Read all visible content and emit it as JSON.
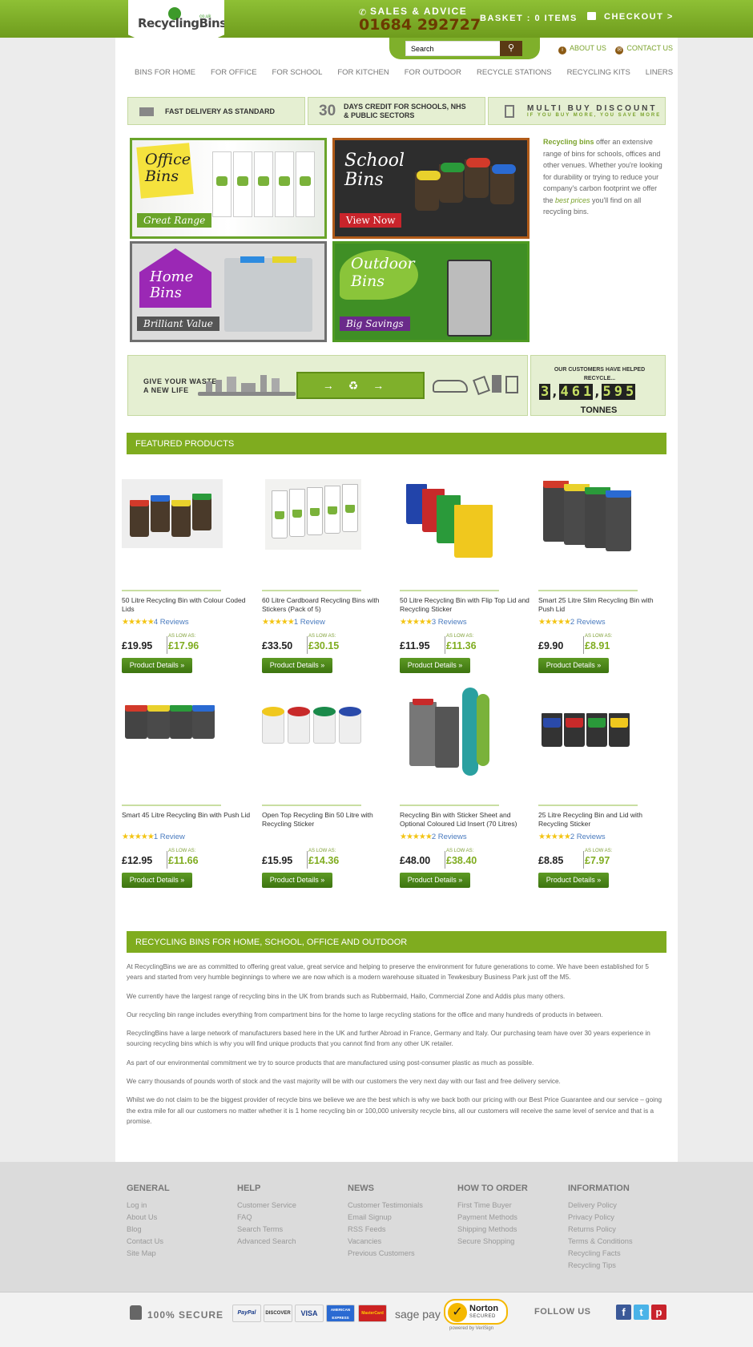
{
  "header": {
    "logo_text": "RecyclingBins",
    "logo_suffix": "co.uk",
    "sales_label": "SALES & ADVICE",
    "phone": "01684 292727",
    "basket": "BASKET : 0 ITEMS",
    "checkout": "CHECKOUT >"
  },
  "search": {
    "placeholder": "Search",
    "value": "Search"
  },
  "toplinks": {
    "about": "ABOUT US",
    "contact": "CONTACT US"
  },
  "nav": [
    "BINS FOR HOME",
    "FOR OFFICE",
    "FOR SCHOOL",
    "FOR KITCHEN",
    "FOR OUTDOOR",
    "RECYCLE STATIONS",
    "RECYCLING KITS",
    "LINERS"
  ],
  "usp": {
    "delivery": "FAST DELIVERY AS STANDARD",
    "credit_num": "30",
    "credit_line1": "DAYS CREDIT FOR SCHOOLS, NHS",
    "credit_line2": "& PUBLIC SECTORS",
    "multibuy": "MULTI BUY DISCOUNT",
    "multibuy_sub": "IF YOU BUY MORE, YOU SAVE MORE"
  },
  "tiles": {
    "office": {
      "heading": "Office Bins",
      "tag": "Great Range"
    },
    "school": {
      "heading": "School Bins",
      "tag": "View Now"
    },
    "home": {
      "heading": "Home Bins",
      "tag": "Brilliant Value"
    },
    "outdoor": {
      "heading": "Outdoor Bins",
      "tag": "Big Savings"
    }
  },
  "blurb": {
    "strong": "Recycling bins",
    "text1": " offer an extensive range of bins for schools, offices and other venues. Whether you're looking for durability or trying to reduce your company's carbon footprint we offer the ",
    "em": "best prices",
    "text2": " you'll find on all recycling bins."
  },
  "life": {
    "line1": "GIVE YOUR WASTE",
    "line2": "A NEW LIFE",
    "counter_title": "OUR CUSTOMERS HAVE HELPED RECYCLE...",
    "digits": [
      "3",
      ",",
      "4",
      "6",
      "1",
      ",",
      "5",
      "9",
      "5"
    ],
    "unit": "TONNES"
  },
  "featured_title": "FEATURED PRODUCTS",
  "products": [
    {
      "name": "50 Litre Recycling Bin with Colour Coded Lids",
      "stars": "★★★★★",
      "reviews": "4 Reviews",
      "price": "£19.95",
      "as_low_as": "AS LOW AS:",
      "sale": "£17.96",
      "button": "Product Details »"
    },
    {
      "name": "60 Litre Cardboard Recycling Bins with Stickers (Pack of 5)",
      "stars": "★★★★★",
      "reviews": "1 Review",
      "price": "£33.50",
      "as_low_as": "AS LOW AS:",
      "sale": "£30.15",
      "button": "Product Details »"
    },
    {
      "name": "50 Litre Recycling Bin with Flip Top Lid and Recycling Sticker",
      "stars": "★★★★★",
      "reviews": "3 Reviews",
      "price": "£11.95",
      "as_low_as": "AS LOW AS:",
      "sale": "£11.36",
      "button": "Product Details »"
    },
    {
      "name": "Smart 25 Litre Slim Recycling Bin with Push Lid",
      "stars": "★★★★★",
      "reviews": "2 Reviews",
      "price": "£9.90",
      "as_low_as": "AS LOW AS:",
      "sale": "£8.91",
      "button": "Product Details »"
    },
    {
      "name": "Smart 45 Litre Recycling Bin with Push Lid",
      "stars": "★★★★★",
      "reviews": "1 Review",
      "price": "£12.95",
      "as_low_as": "AS LOW AS:",
      "sale": "£11.66",
      "button": "Product Details »"
    },
    {
      "name": "Open Top Recycling Bin 50 Litre with Recycling Sticker",
      "stars": "",
      "reviews": "",
      "price": "£15.95",
      "as_low_as": "AS LOW AS:",
      "sale": "£14.36",
      "button": "Product Details »"
    },
    {
      "name": "Recycling Bin with Sticker Sheet and Optional Coloured Lid Insert (70 Litres)",
      "stars": "★★★★★",
      "reviews": "2 Reviews",
      "price": "£48.00",
      "as_low_as": "AS LOW AS:",
      "sale": "£38.40",
      "button": "Product Details »"
    },
    {
      "name": "25 Litre Recycling Bin and Lid with Recycling Sticker",
      "stars": "★★★★★",
      "reviews": "2 Reviews",
      "price": "£8.85",
      "as_low_as": "AS LOW AS:",
      "sale": "£7.97",
      "button": "Product Details »"
    }
  ],
  "about_title": "RECYCLING BINS FOR HOME, SCHOOL, OFFICE AND OUTDOOR",
  "about": [
    "At RecyclingBins we are as committed to offering great value, great service and helping to preserve the environment for future generations to come. We have been established for 5 years and started from very humble beginnings to where we are now which is a modern warehouse situated in Tewkesbury Business Park just off the M5.",
    "We currently have the largest range of recycling bins in the UK from brands such as Rubbermaid, Hailo, Commercial Zone and Addis plus many others.",
    "Our recycling bin range includes everything from compartment bins for the home to large recycling stations for the office and many hundreds of products in between.",
    "RecyclingBins have a large network of manufacturers based here in the UK and further Abroad in France, Germany and Italy. Our purchasing team have over 30 years experience in sourcing recycling bins which is why you will find unique products that you cannot find from any other UK retailer.",
    "As part of our environmental commitment we try to source products that are manufactured using post-consumer plastic as much as possible.",
    "We carry thousands of pounds worth of stock and the vast majority will be with our customers the very next day with our fast and free delivery service.",
    "Whilst we do not claim to be the biggest provider of recycle bins we believe we are the best which is why we back both our pricing with our Best Price Guarantee and our service – going the extra mile for all our customers no matter whether it is 1 home recycling bin or 100,000 university recycle bins, all our customers will receive the same level of service and that is a promise."
  ],
  "footer": [
    {
      "title": "GENERAL",
      "links": [
        "Log in",
        "About Us",
        "Blog",
        "Contact Us",
        "Site Map"
      ]
    },
    {
      "title": "HELP",
      "links": [
        "Customer Service",
        "FAQ",
        "Search Terms",
        "Advanced Search"
      ]
    },
    {
      "title": "NEWS",
      "links": [
        "Customer Testimonials",
        "Email Signup",
        "RSS Feeds",
        "Vacancies",
        "Previous Customers"
      ]
    },
    {
      "title": "HOW TO ORDER",
      "links": [
        "First Time Buyer",
        "Payment Methods",
        "Shipping Methods",
        "Secure Shopping"
      ]
    },
    {
      "title": "INFORMATION",
      "links": [
        "Delivery Policy",
        "Privacy Policy",
        "Returns Policy",
        "Terms & Conditions",
        "Recycling Facts",
        "Recycling Tips"
      ]
    }
  ],
  "bottom": {
    "secure": "100% SECURE",
    "paypal": "PayPal",
    "discover": "DISCOVER",
    "visa": "VISA",
    "amex": "AMERICAN EXPRESS",
    "mastercard": "MasterCard",
    "sagepay": "sage pay",
    "norton": "Norton",
    "norton_sub": "SECURED",
    "verisign": "powered by VeriSign",
    "follow": "FOLLOW US",
    "facebook": "f",
    "twitter": "t",
    "pinterest": "p"
  }
}
